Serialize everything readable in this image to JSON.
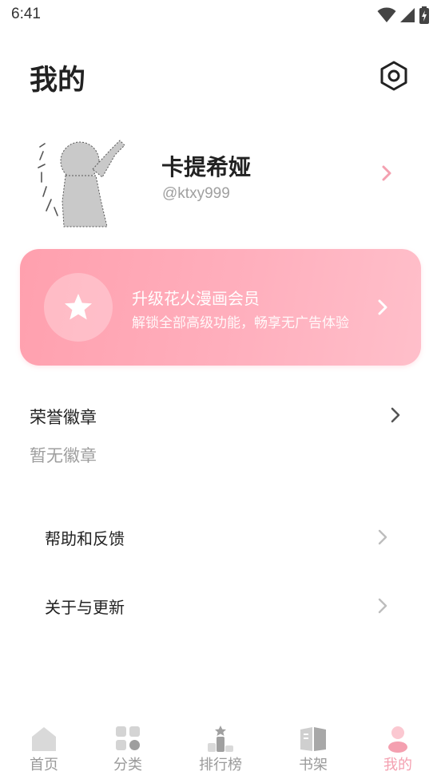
{
  "status_bar": {
    "time": "6:41",
    "icons": [
      "wifi-icon",
      "signal-icon",
      "battery-charging-icon"
    ]
  },
  "header": {
    "title": "我的",
    "settings_icon": "gear-hexagon-icon"
  },
  "profile": {
    "name": "卡提希娅",
    "handle": "@ktxy999",
    "avatar_icon": "anime-silhouette-avatar"
  },
  "vip_banner": {
    "title": "升级花火漫画会员",
    "subtitle": "解锁全部高级功能，畅享无广告体验",
    "icon": "star-icon"
  },
  "badges": {
    "title": "荣誉徽章",
    "empty_text": "暂无徽章"
  },
  "menu": [
    {
      "label": "帮助和反馈"
    },
    {
      "label": "关于与更新"
    }
  ],
  "bottom_nav": [
    {
      "label": "首页",
      "icon": "home-icon",
      "active": false
    },
    {
      "label": "分类",
      "icon": "category-grid-icon",
      "active": false
    },
    {
      "label": "排行榜",
      "icon": "ranking-podium-icon",
      "active": false
    },
    {
      "label": "书架",
      "icon": "bookshelf-icon",
      "active": false
    },
    {
      "label": "我的",
      "icon": "profile-icon",
      "active": true
    }
  ],
  "colors": {
    "accent": "#f4a0b0",
    "vip_gradient_start": "#ffa0ae",
    "vip_gradient_end": "#ffbfca",
    "inactive_nav": "#9a9a9a"
  }
}
